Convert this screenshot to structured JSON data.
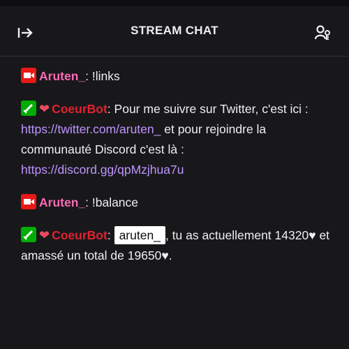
{
  "header": {
    "title": "STREAM CHAT",
    "collapse_icon": "collapse-arrow-icon",
    "users_icon": "users-icon"
  },
  "colors": {
    "background": "#18181b",
    "broadcaster_name": "#ff69b4",
    "bot_name": "#e0212f",
    "link": "#bf94ff",
    "broadcaster_badge": "#e91916",
    "moderator_badge": "#00ad03"
  },
  "messages": [
    {
      "user": "Aruten_",
      "separator": ":",
      "text": " !links"
    },
    {
      "user": "CoeurBot",
      "separator": ":",
      "text1": " Pour me suivre sur Twitter, c'est ici : ",
      "link1": "https://twitter.com/aruten_",
      "text2": " et pour rejoindre la communauté Discord c'est là : ",
      "link2": "https://discord.gg/qpMzjhua7u"
    },
    {
      "user": "Aruten_",
      "separator": ":",
      "text": " !balance"
    },
    {
      "user": "CoeurBot",
      "separator": ":",
      "mention": "aruten_",
      "text": ", tu as actuellement 14320♥ et amassé un total de 19650♥."
    }
  ],
  "badges": {
    "broadcaster_icon": "camera-icon",
    "moderator_icon": "sword-icon",
    "heart": "❤"
  }
}
